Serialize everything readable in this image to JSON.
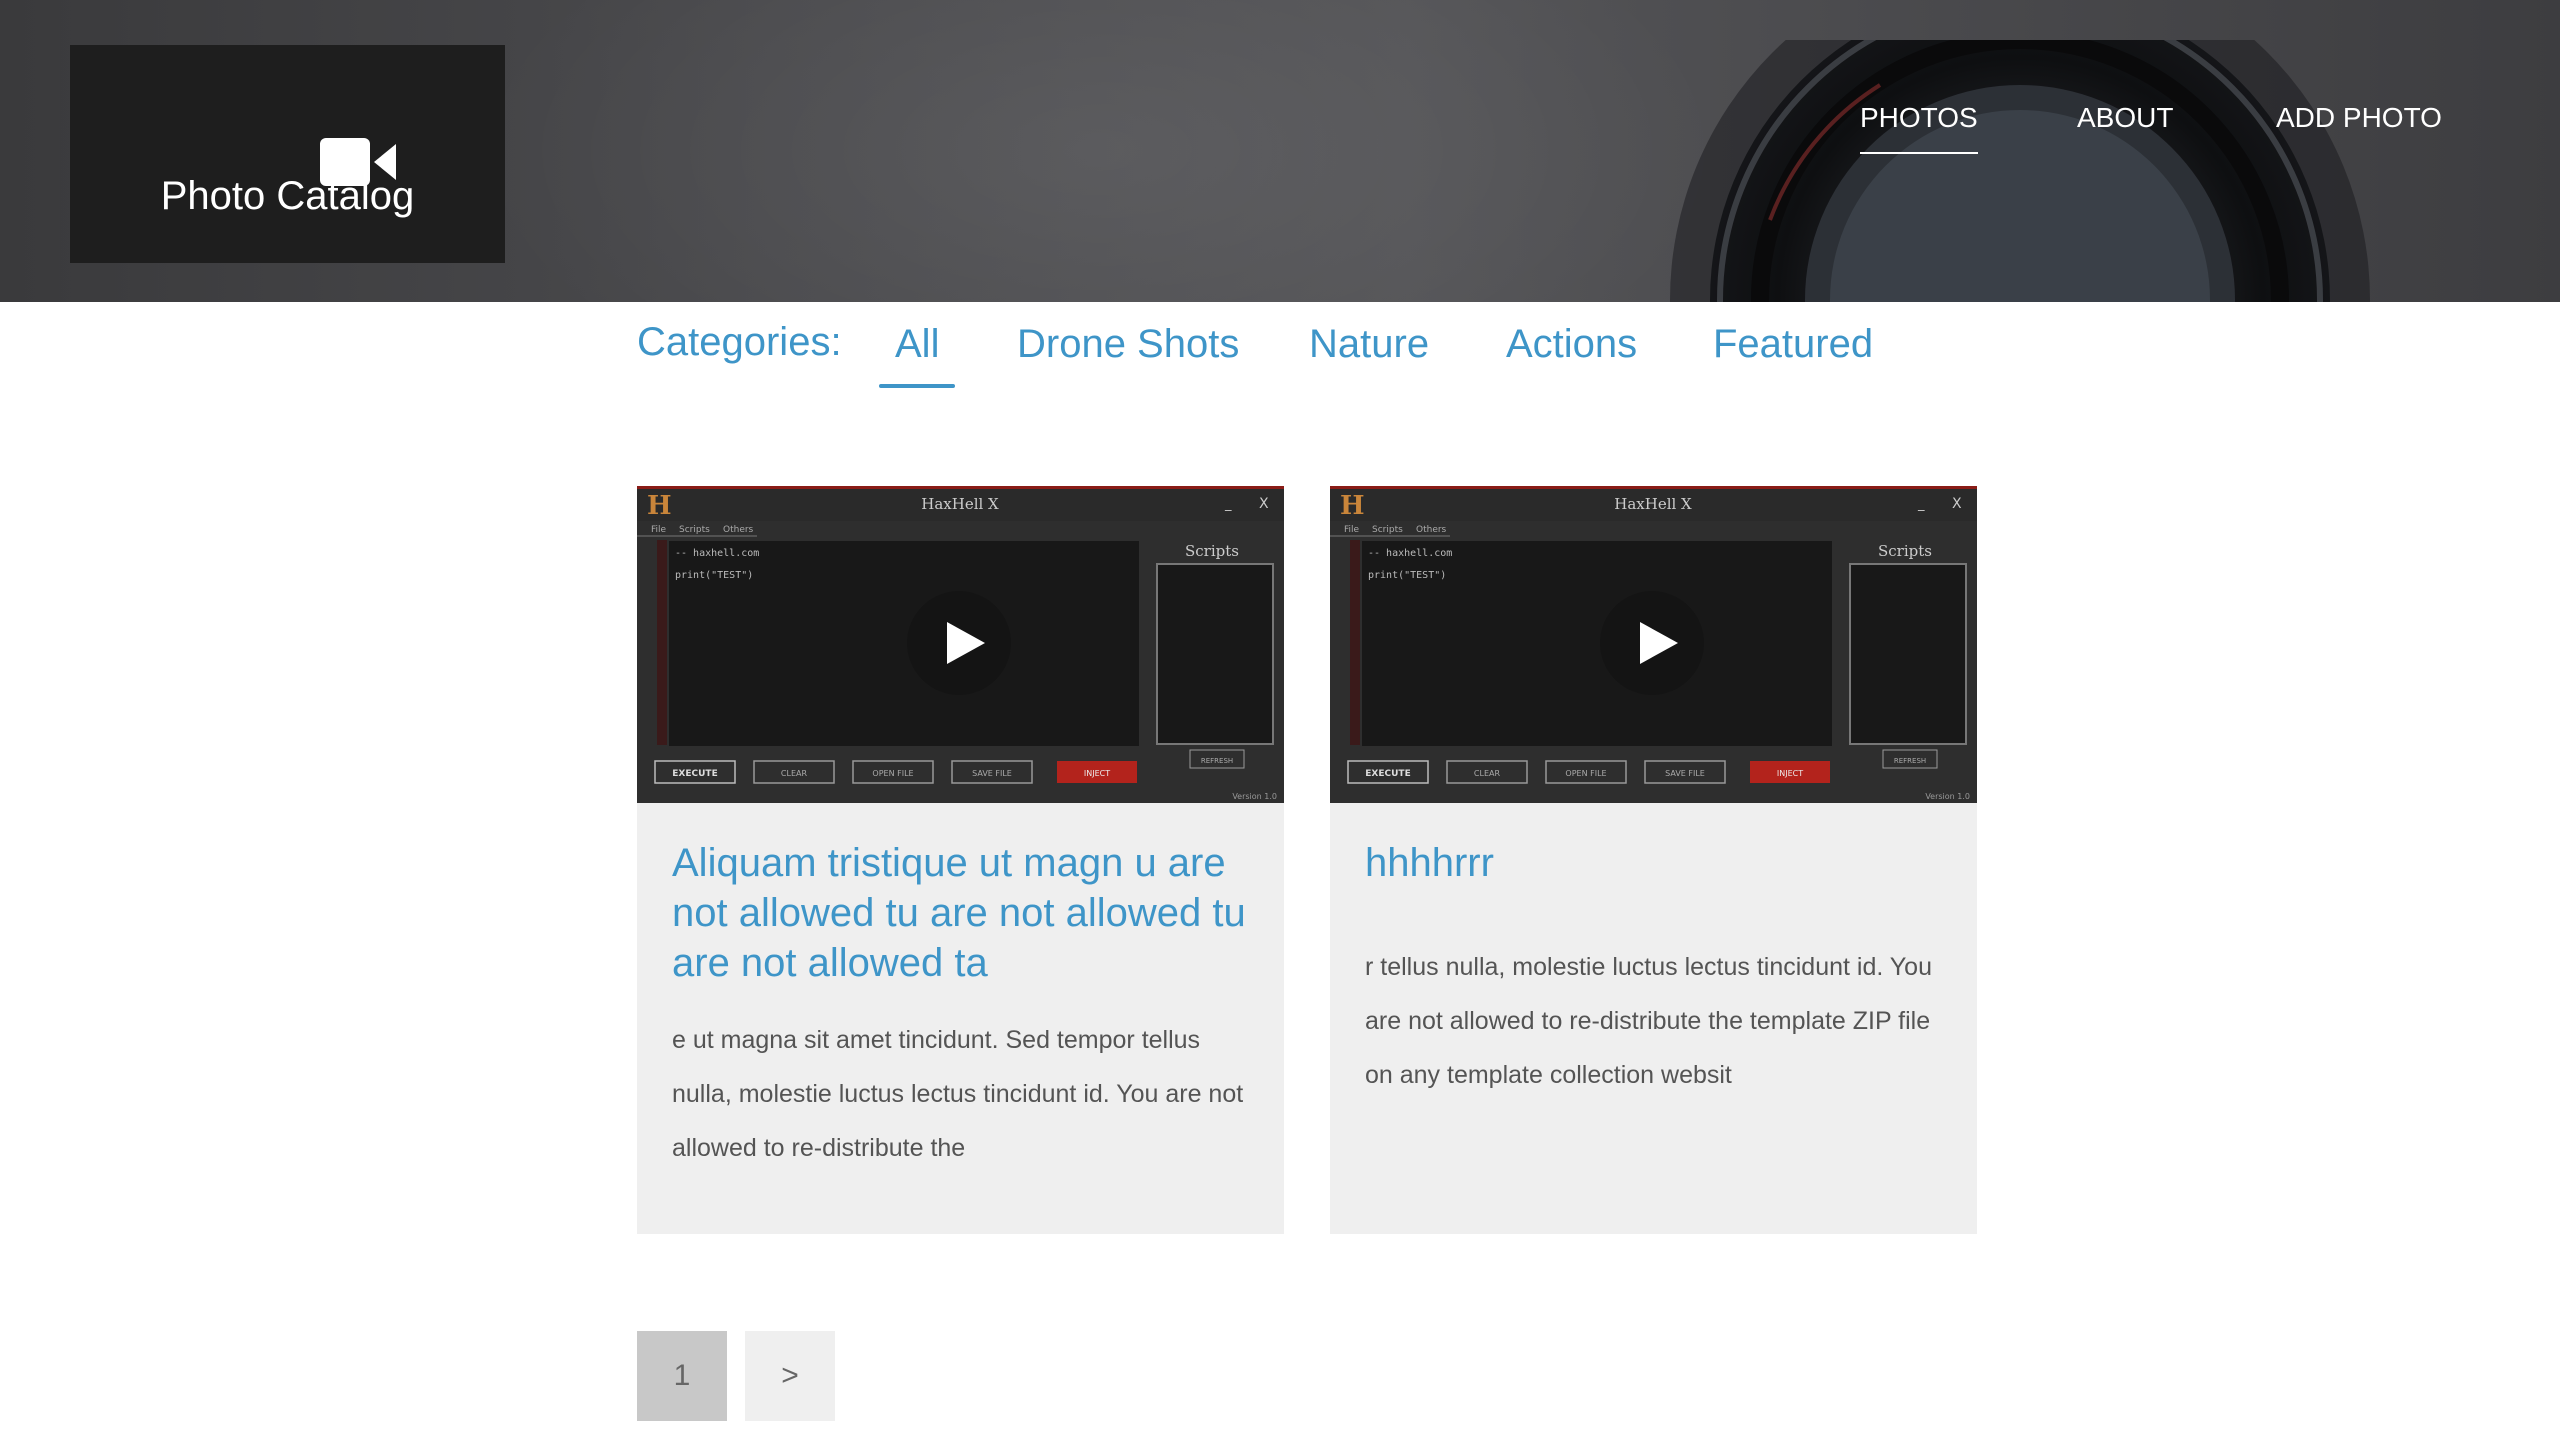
{
  "brand": {
    "title": "Photo Catalog",
    "icon": "video-camera-icon"
  },
  "nav": {
    "items": [
      {
        "label": "PHOTOS",
        "active": true
      },
      {
        "label": "ABOUT",
        "active": false
      },
      {
        "label": "ADD PHOTO",
        "active": false
      }
    ]
  },
  "categories": {
    "label": "Categories:",
    "items": [
      {
        "label": "All",
        "active": true
      },
      {
        "label": "Drone Shots",
        "active": false
      },
      {
        "label": "Nature",
        "active": false
      },
      {
        "label": "Actions",
        "active": false
      },
      {
        "label": "Featured",
        "active": false
      }
    ]
  },
  "thumbnail": {
    "window_title": "HaxHell X",
    "menu": [
      "File",
      "Scripts",
      "Others"
    ],
    "code_line1": "-- haxhell.com",
    "code_line2": "print(\"TEST\")",
    "side_panel": "Scripts",
    "buttons": [
      "EXECUTE",
      "CLEAR",
      "OPEN FILE",
      "SAVE FILE",
      "INJECT"
    ],
    "refresh": "REFRESH",
    "version": "Version 1.0",
    "minimize": "_",
    "close": "X"
  },
  "cards": [
    {
      "title": "Aliquam tristique ut magn u are not allowed tu are not allowed tu are not allowed ta",
      "description": "e ut magna sit amet tincidunt. Sed tempor tellus nulla, molestie luctus lectus tincidunt id. You are not allowed to re-distribute the"
    },
    {
      "title": "hhhhrrr",
      "description": "r tellus nulla, molestie luctus lectus tincidunt id. You are not allowed to re-distribute the template ZIP file on any template collection websit"
    }
  ],
  "pagination": {
    "current": "1",
    "next": ">"
  },
  "colors": {
    "accent": "#3e95c8",
    "card_bg": "#efefef",
    "logo_bg": "#1e1e1e",
    "inject": "#b3231c"
  }
}
